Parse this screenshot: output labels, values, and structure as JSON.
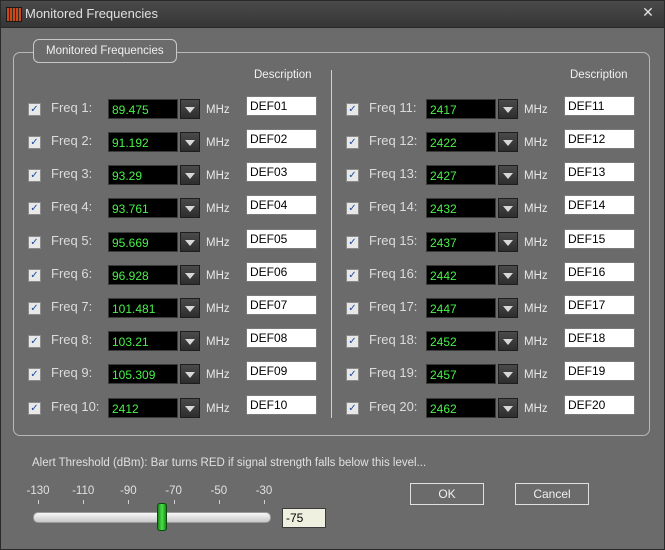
{
  "window": {
    "title": "Monitored Frequencies",
    "close_glyph": "✕",
    "app_icon": "spectrum-analyzer-icon"
  },
  "group": {
    "label": "Monitored Frequencies",
    "description_header": "Description"
  },
  "unit": "MHz",
  "check_glyph": "✓",
  "frequencies": [
    {
      "label": "Freq 1:",
      "value": "89.475",
      "desc": "DEF01",
      "checked": true
    },
    {
      "label": "Freq 2:",
      "value": "91.192",
      "desc": "DEF02",
      "checked": true
    },
    {
      "label": "Freq 3:",
      "value": "93.29",
      "desc": "DEF03",
      "checked": true
    },
    {
      "label": "Freq 4:",
      "value": "93.761",
      "desc": "DEF04",
      "checked": true
    },
    {
      "label": "Freq 5:",
      "value": "95.669",
      "desc": "DEF05",
      "checked": true
    },
    {
      "label": "Freq 6:",
      "value": "96.928",
      "desc": "DEF06",
      "checked": true
    },
    {
      "label": "Freq 7:",
      "value": "101.481",
      "desc": "DEF07",
      "checked": true
    },
    {
      "label": "Freq 8:",
      "value": "103.21",
      "desc": "DEF08",
      "checked": true
    },
    {
      "label": "Freq 9:",
      "value": "105.309",
      "desc": "DEF09",
      "checked": true
    },
    {
      "label": "Freq 10:",
      "value": "2412",
      "desc": "DEF10",
      "checked": true
    },
    {
      "label": "Freq 11:",
      "value": "2417",
      "desc": "DEF11",
      "checked": true
    },
    {
      "label": "Freq 12:",
      "value": "2422",
      "desc": "DEF12",
      "checked": true
    },
    {
      "label": "Freq 13:",
      "value": "2427",
      "desc": "DEF13",
      "checked": true
    },
    {
      "label": "Freq 14:",
      "value": "2432",
      "desc": "DEF14",
      "checked": true
    },
    {
      "label": "Freq 15:",
      "value": "2437",
      "desc": "DEF15",
      "checked": true
    },
    {
      "label": "Freq 16:",
      "value": "2442",
      "desc": "DEF16",
      "checked": true
    },
    {
      "label": "Freq 17:",
      "value": "2447",
      "desc": "DEF17",
      "checked": true
    },
    {
      "label": "Freq 18:",
      "value": "2452",
      "desc": "DEF18",
      "checked": true
    },
    {
      "label": "Freq 19:",
      "value": "2457",
      "desc": "DEF19",
      "checked": true
    },
    {
      "label": "Freq 20:",
      "value": "2462",
      "desc": "DEF20",
      "checked": true
    }
  ],
  "alert": {
    "text": "Alert Threshold (dBm): Bar turns RED if signal strength falls below this level...",
    "ticks": [
      "-130",
      "-110",
      "-90",
      "-70",
      "-50",
      "-30"
    ],
    "min": -130,
    "max": -30,
    "value": -75,
    "value_text": "-75"
  },
  "buttons": {
    "ok": "OK",
    "cancel": "Cancel"
  },
  "colors": {
    "freq_text": "#4af04a",
    "slider_thumb": "#3ac83a"
  }
}
